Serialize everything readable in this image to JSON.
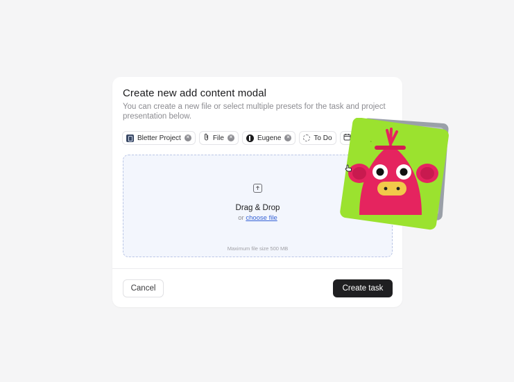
{
  "modal": {
    "title": "Create new add content modal",
    "subtitle": "You can create a new file or select multiple presets for the task and project presentation below."
  },
  "chips": {
    "project": {
      "label": "Bletter Project",
      "icon": "project-icon"
    },
    "file": {
      "label": "File",
      "icon": "paperclip-icon"
    },
    "assignee": {
      "label": "Eugene",
      "icon": "user-icon"
    },
    "status": {
      "label": "To Do",
      "icon": "dashed-circle-icon"
    },
    "date": {
      "icon": "calendar-icon"
    }
  },
  "dropzone": {
    "title": "Drag & Drop",
    "or_text": "or",
    "choose_label": "choose file",
    "max_size": "Maximum file size 500 MB"
  },
  "footer": {
    "cancel_label": "Cancel",
    "create_label": "Create task"
  },
  "colors": {
    "primary_button": "#1f1f21",
    "link": "#3461d6",
    "dropzone_bg": "#f3f6fd",
    "dropzone_border": "#b9c5e6",
    "art_green": "#9be22f",
    "art_pink": "#e5245f"
  }
}
